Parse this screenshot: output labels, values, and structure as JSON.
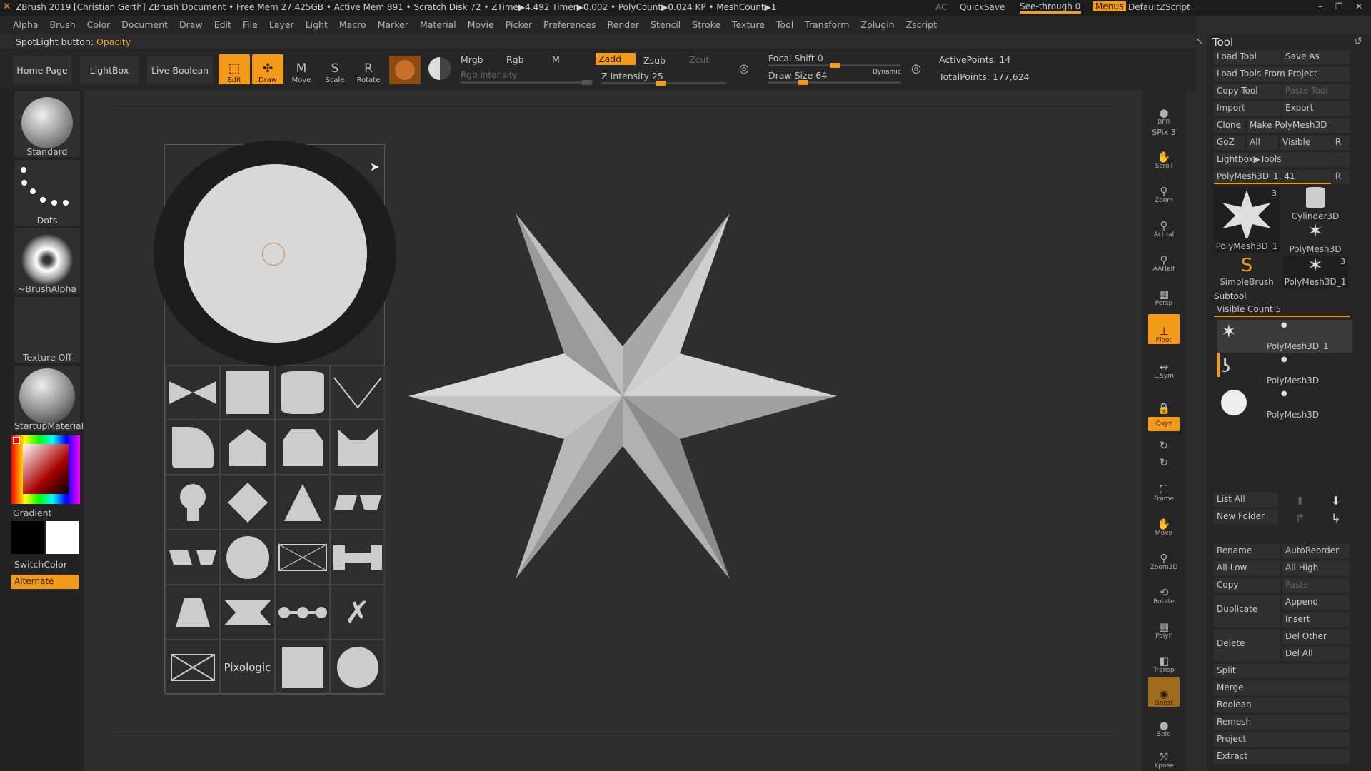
{
  "titlebar": {
    "text": "ZBrush 2019 [Christian Gerth]   ZBrush Document      • Free Mem 27.425GB • Active Mem 891 • Scratch Disk 72 • ZTime▶4.492 Timer▶0.002 • PolyCount▶0.024 KP • MeshCount▶1",
    "ac": "AC",
    "quicksave": "QuickSave",
    "seethrough": "See-through  0",
    "menus": "Menus",
    "script": "DefaultZScript"
  },
  "menu": [
    "Alpha",
    "Brush",
    "Color",
    "Document",
    "Draw",
    "Edit",
    "File",
    "Layer",
    "Light",
    "Macro",
    "Marker",
    "Material",
    "Movie",
    "Picker",
    "Preferences",
    "Render",
    "Stencil",
    "Stroke",
    "Texture",
    "Tool",
    "Transform",
    "Zplugin",
    "Zscript"
  ],
  "spotlight": {
    "label": "SpotLight button:",
    "value": "Opacity"
  },
  "toolbar": {
    "home": "Home Page",
    "lightbox": "LightBox",
    "liveboolean": "Live Boolean",
    "tools": [
      "Edit",
      "Draw",
      "Move",
      "Scale",
      "Rotate"
    ],
    "mrgb": "Mrgb",
    "rgb": "Rgb",
    "m": "M",
    "zadd": "Zadd",
    "zsub": "Zsub",
    "zcut": "Zcut",
    "rgb_intensity": "Rgb Intensity",
    "z_intensity": "Z Intensity 25",
    "focal": "Focal Shift 0",
    "drawsize": "Draw Size 64",
    "dynamic": "Dynamic",
    "active": "ActivePoints: 14",
    "total": "TotalPoints: 177,624"
  },
  "left": {
    "brush": "Standard",
    "stroke": "Dots",
    "alpha": "~BrushAlpha",
    "texture": "Texture Off",
    "material": "StartupMaterial",
    "gradient": "Gradient",
    "switch": "SwitchColor",
    "alternate": "Alternate"
  },
  "spotlight_grid": {
    "pixologic": "Pixologic"
  },
  "right": [
    "BPR",
    "SPix 3",
    "Scroll",
    "Zoom",
    "Actual",
    "AAHalf",
    "Persp",
    "Floor",
    "L.Sym",
    "",
    "Qxyz",
    "",
    "",
    "Frame",
    "Move",
    "Zoom3D",
    "Rotate",
    "PolyF",
    "Transp",
    "Ghost",
    "Solo",
    "Xpose"
  ],
  "panel": {
    "title": "Tool",
    "load": "Load Tool",
    "saveas": "Save As",
    "loadproj": "Load Tools From Project",
    "copy": "Copy Tool",
    "paste": "Paste Tool",
    "import": "Import",
    "export": "Export",
    "clone": "Clone",
    "make": "Make PolyMesh3D",
    "goz": "GoZ",
    "all": "All",
    "visible": "Visible",
    "r": "R",
    "lightbox": "Lightbox▶Tools",
    "current": "PolyMesh3D_1. 41",
    "thumbs": [
      {
        "label": "PolyMesh3D_1",
        "count": "3"
      },
      {
        "label": "Cylinder3D",
        "count": ""
      },
      {
        "label": "PolyMesh3D",
        "count": ""
      },
      {
        "label": "SimpleBrush",
        "count": ""
      },
      {
        "label": "PolyMesh3D_1",
        "count": "3"
      }
    ],
    "subtool": "Subtool",
    "visiblecount": "Visible Count 5",
    "subs": [
      "PolyMesh3D_1",
      "PolyMesh3D",
      "PolyMesh3D"
    ],
    "listall": "List All",
    "newfolder": "New Folder",
    "rename": "Rename",
    "autoreorder": "AutoReorder",
    "alllow": "All Low",
    "allhigh": "All High",
    "copy2": "Copy",
    "paste2": "Paste",
    "duplicate": "Duplicate",
    "append": "Append",
    "insert": "Insert",
    "delete": "Delete",
    "delother": "Del Other",
    "delall": "Del All",
    "split": "Split",
    "merge": "Merge",
    "boolean": "Boolean",
    "remesh": "Remesh",
    "project": "Project",
    "extract": "Extract"
  },
  "colors": {
    "accent": "#f39a1a"
  }
}
